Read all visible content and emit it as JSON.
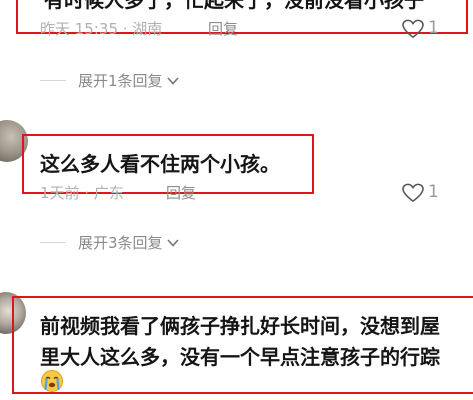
{
  "comment1": {
    "text": "有时候人多了，忙起来了，没前没看小孩子",
    "meta": "昨天 15:35 · 湖南",
    "reply_label": "回复",
    "likes": "1",
    "expand_label": "展开1条回复"
  },
  "comment2": {
    "text": "这么多人看不住两个小孩。",
    "meta": "1天前 · 广东",
    "reply_label": "回复",
    "likes": "1",
    "expand_label": "展开3条回复"
  },
  "comment3": {
    "line1": "前视频我看了俩孩子挣扎好长时间，没想到屋",
    "line2": "里大人这么多，没有一个早点注意孩子的行踪",
    "emoji": "crying-face-icon"
  },
  "colors": {
    "highlight_border": "#e0141c",
    "meta_text": "#b0b0b0",
    "body_text": "#151515"
  }
}
